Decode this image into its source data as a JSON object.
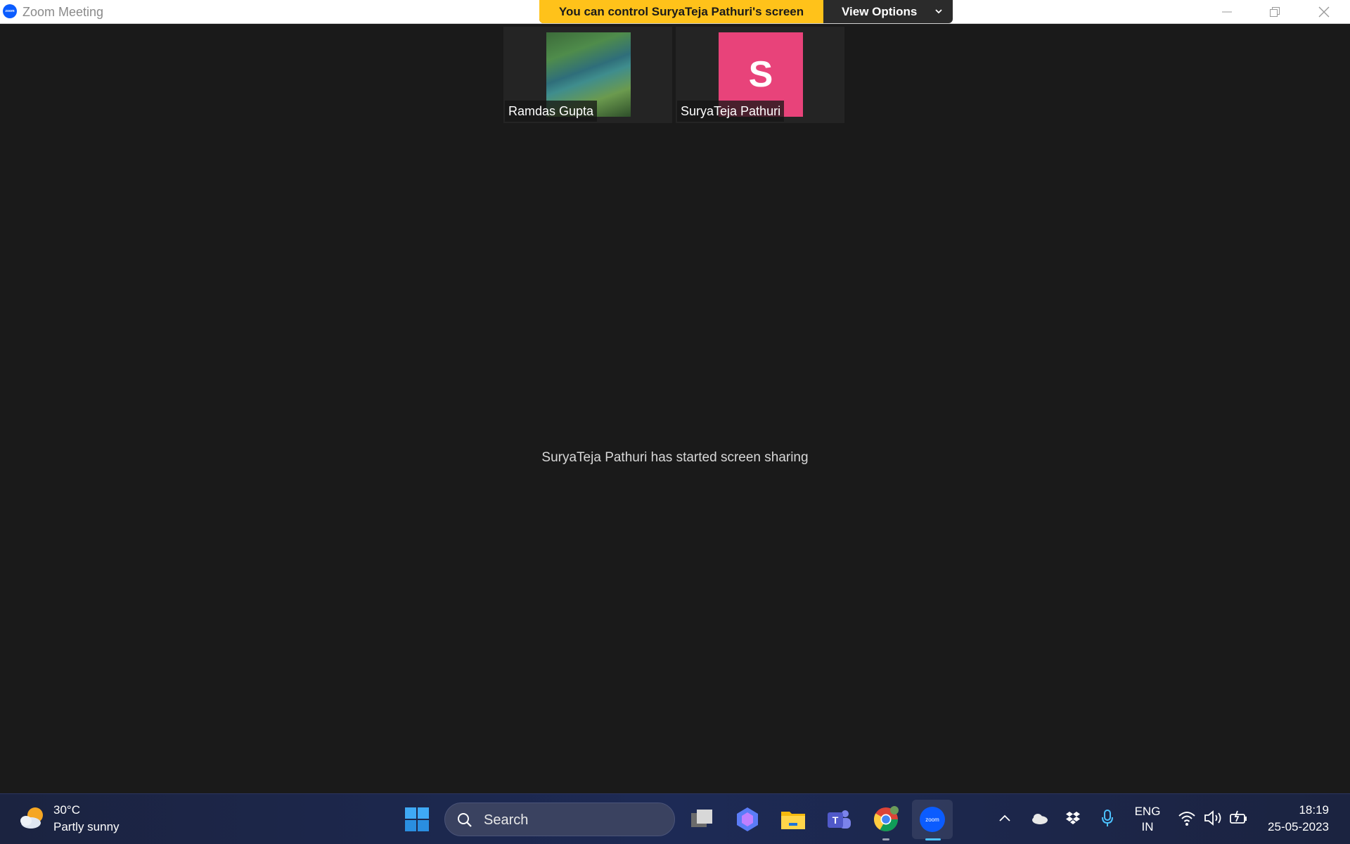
{
  "window": {
    "title": "Zoom Meeting",
    "app_icon_text": "zoom"
  },
  "banner": {
    "message": "You can control SuryaTeja Pathuri's screen",
    "view_options_label": "View Options",
    "colors": {
      "message_bg": "#ffc21a",
      "options_bg": "#2b2b2b"
    }
  },
  "participants": [
    {
      "name": "Ramdas Gupta",
      "video": "photo"
    },
    {
      "name": "SuryaTeja Pathuri",
      "avatar_letter": "S",
      "avatar_color": "#e8437a"
    }
  ],
  "main": {
    "status_message": "SuryaTeja Pathuri has started screen sharing"
  },
  "taskbar": {
    "weather": {
      "temperature": "30°C",
      "condition": "Partly sunny"
    },
    "search": {
      "placeholder": "Search"
    },
    "pinned_apps": [
      "start-icon",
      "task-view-icon",
      "copilot-icon",
      "file-explorer-icon",
      "teams-icon",
      "chrome-icon",
      "zoom-icon"
    ],
    "active_app": "zoom-icon",
    "tray": {
      "language_line1": "ENG",
      "language_line2": "IN",
      "time": "18:19",
      "date": "25-05-2023"
    }
  }
}
